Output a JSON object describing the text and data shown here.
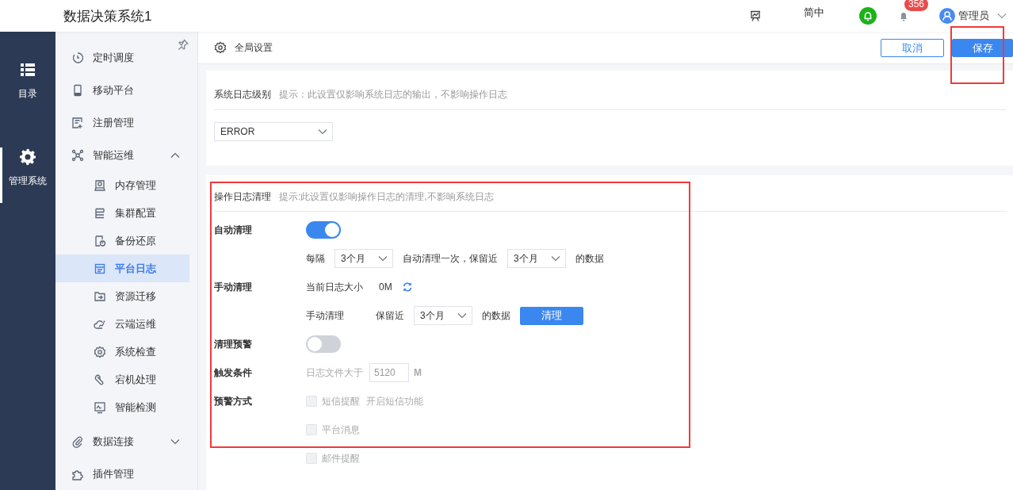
{
  "header": {
    "title": "数据决策系统1",
    "language": "简中",
    "badge": "356",
    "user": "管理员"
  },
  "rail": [
    {
      "label": "目录",
      "selected": false
    },
    {
      "label": "管理系统",
      "selected": true
    }
  ],
  "sidebar": {
    "items": [
      {
        "label": "定时调度",
        "selected": false
      },
      {
        "label": "移动平台",
        "selected": false
      },
      {
        "label": "注册管理",
        "selected": false
      },
      {
        "label": "智能运维",
        "selected": false,
        "expanded": true,
        "children": [
          {
            "label": "内存管理",
            "selected": false
          },
          {
            "label": "集群配置",
            "selected": false
          },
          {
            "label": "备份还原",
            "selected": false
          },
          {
            "label": "平台日志",
            "selected": true
          },
          {
            "label": "资源迁移",
            "selected": false
          },
          {
            "label": "云端运维",
            "selected": false
          },
          {
            "label": "系统检查",
            "selected": false
          },
          {
            "label": "宕机处理",
            "selected": false
          },
          {
            "label": "智能检测",
            "selected": false
          }
        ]
      },
      {
        "label": "数据连接",
        "selected": false,
        "expanded": false
      },
      {
        "label": "插件管理",
        "selected": false
      }
    ]
  },
  "toolbar": {
    "title": "全局设置",
    "buttons": [
      {
        "label": "取消",
        "kind": "secondary",
        "highlighted": false
      },
      {
        "label": "保存",
        "kind": "primary",
        "highlighted": true
      }
    ]
  },
  "system_log": {
    "label": "系统日志级别",
    "hint": "提示：此设置仅影响系统日志的输出，不影响操作日志",
    "level": "ERROR"
  },
  "operation_log": {
    "label": "操作日志清理",
    "hint": "提示:此设置仅影响操作日志的清理,不影响系统日志",
    "highlighted": true,
    "auto_clean": {
      "label": "自动清理",
      "on": true,
      "prefix": "每隔",
      "interval": "3个月",
      "middle": "自动清理一次，保留近",
      "retain": "3个月",
      "suffix": "的数据"
    },
    "manual_clean": {
      "label": "手动清理",
      "size_label": "当前日志大小",
      "size": "0M",
      "action_label": "手动清理",
      "retain_prefix": "保留近",
      "retain": "3个月",
      "suffix": "的数据",
      "button": "清理"
    },
    "warning": {
      "label": "清理预警",
      "on": false
    },
    "trigger": {
      "label": "触发条件",
      "prefix": "日志文件大于",
      "value": "5120",
      "unit": "M",
      "disabled": true
    },
    "methods": {
      "label": "预警方式",
      "options": [
        {
          "label": "短信提醒",
          "checked": false,
          "disabled": true,
          "link": "开启短信功能"
        },
        {
          "label": "平台消息",
          "checked": false,
          "disabled": true
        },
        {
          "label": "邮件提醒",
          "checked": false,
          "disabled": true
        }
      ]
    }
  }
}
